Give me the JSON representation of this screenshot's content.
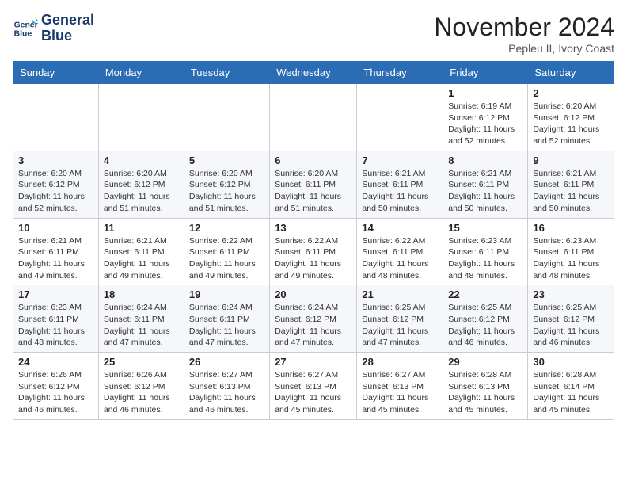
{
  "logo": {
    "line1": "General",
    "line2": "Blue"
  },
  "title": "November 2024",
  "location": "Pepleu II, Ivory Coast",
  "days_of_week": [
    "Sunday",
    "Monday",
    "Tuesday",
    "Wednesday",
    "Thursday",
    "Friday",
    "Saturday"
  ],
  "weeks": [
    [
      {
        "day": "",
        "info": ""
      },
      {
        "day": "",
        "info": ""
      },
      {
        "day": "",
        "info": ""
      },
      {
        "day": "",
        "info": ""
      },
      {
        "day": "",
        "info": ""
      },
      {
        "day": "1",
        "info": "Sunrise: 6:19 AM\nSunset: 6:12 PM\nDaylight: 11 hours and 52 minutes."
      },
      {
        "day": "2",
        "info": "Sunrise: 6:20 AM\nSunset: 6:12 PM\nDaylight: 11 hours and 52 minutes."
      }
    ],
    [
      {
        "day": "3",
        "info": "Sunrise: 6:20 AM\nSunset: 6:12 PM\nDaylight: 11 hours and 52 minutes."
      },
      {
        "day": "4",
        "info": "Sunrise: 6:20 AM\nSunset: 6:12 PM\nDaylight: 11 hours and 51 minutes."
      },
      {
        "day": "5",
        "info": "Sunrise: 6:20 AM\nSunset: 6:12 PM\nDaylight: 11 hours and 51 minutes."
      },
      {
        "day": "6",
        "info": "Sunrise: 6:20 AM\nSunset: 6:11 PM\nDaylight: 11 hours and 51 minutes."
      },
      {
        "day": "7",
        "info": "Sunrise: 6:21 AM\nSunset: 6:11 PM\nDaylight: 11 hours and 50 minutes."
      },
      {
        "day": "8",
        "info": "Sunrise: 6:21 AM\nSunset: 6:11 PM\nDaylight: 11 hours and 50 minutes."
      },
      {
        "day": "9",
        "info": "Sunrise: 6:21 AM\nSunset: 6:11 PM\nDaylight: 11 hours and 50 minutes."
      }
    ],
    [
      {
        "day": "10",
        "info": "Sunrise: 6:21 AM\nSunset: 6:11 PM\nDaylight: 11 hours and 49 minutes."
      },
      {
        "day": "11",
        "info": "Sunrise: 6:21 AM\nSunset: 6:11 PM\nDaylight: 11 hours and 49 minutes."
      },
      {
        "day": "12",
        "info": "Sunrise: 6:22 AM\nSunset: 6:11 PM\nDaylight: 11 hours and 49 minutes."
      },
      {
        "day": "13",
        "info": "Sunrise: 6:22 AM\nSunset: 6:11 PM\nDaylight: 11 hours and 49 minutes."
      },
      {
        "day": "14",
        "info": "Sunrise: 6:22 AM\nSunset: 6:11 PM\nDaylight: 11 hours and 48 minutes."
      },
      {
        "day": "15",
        "info": "Sunrise: 6:23 AM\nSunset: 6:11 PM\nDaylight: 11 hours and 48 minutes."
      },
      {
        "day": "16",
        "info": "Sunrise: 6:23 AM\nSunset: 6:11 PM\nDaylight: 11 hours and 48 minutes."
      }
    ],
    [
      {
        "day": "17",
        "info": "Sunrise: 6:23 AM\nSunset: 6:11 PM\nDaylight: 11 hours and 48 minutes."
      },
      {
        "day": "18",
        "info": "Sunrise: 6:24 AM\nSunset: 6:11 PM\nDaylight: 11 hours and 47 minutes."
      },
      {
        "day": "19",
        "info": "Sunrise: 6:24 AM\nSunset: 6:11 PM\nDaylight: 11 hours and 47 minutes."
      },
      {
        "day": "20",
        "info": "Sunrise: 6:24 AM\nSunset: 6:12 PM\nDaylight: 11 hours and 47 minutes."
      },
      {
        "day": "21",
        "info": "Sunrise: 6:25 AM\nSunset: 6:12 PM\nDaylight: 11 hours and 47 minutes."
      },
      {
        "day": "22",
        "info": "Sunrise: 6:25 AM\nSunset: 6:12 PM\nDaylight: 11 hours and 46 minutes."
      },
      {
        "day": "23",
        "info": "Sunrise: 6:25 AM\nSunset: 6:12 PM\nDaylight: 11 hours and 46 minutes."
      }
    ],
    [
      {
        "day": "24",
        "info": "Sunrise: 6:26 AM\nSunset: 6:12 PM\nDaylight: 11 hours and 46 minutes."
      },
      {
        "day": "25",
        "info": "Sunrise: 6:26 AM\nSunset: 6:12 PM\nDaylight: 11 hours and 46 minutes."
      },
      {
        "day": "26",
        "info": "Sunrise: 6:27 AM\nSunset: 6:13 PM\nDaylight: 11 hours and 46 minutes."
      },
      {
        "day": "27",
        "info": "Sunrise: 6:27 AM\nSunset: 6:13 PM\nDaylight: 11 hours and 45 minutes."
      },
      {
        "day": "28",
        "info": "Sunrise: 6:27 AM\nSunset: 6:13 PM\nDaylight: 11 hours and 45 minutes."
      },
      {
        "day": "29",
        "info": "Sunrise: 6:28 AM\nSunset: 6:13 PM\nDaylight: 11 hours and 45 minutes."
      },
      {
        "day": "30",
        "info": "Sunrise: 6:28 AM\nSunset: 6:14 PM\nDaylight: 11 hours and 45 minutes."
      }
    ]
  ]
}
